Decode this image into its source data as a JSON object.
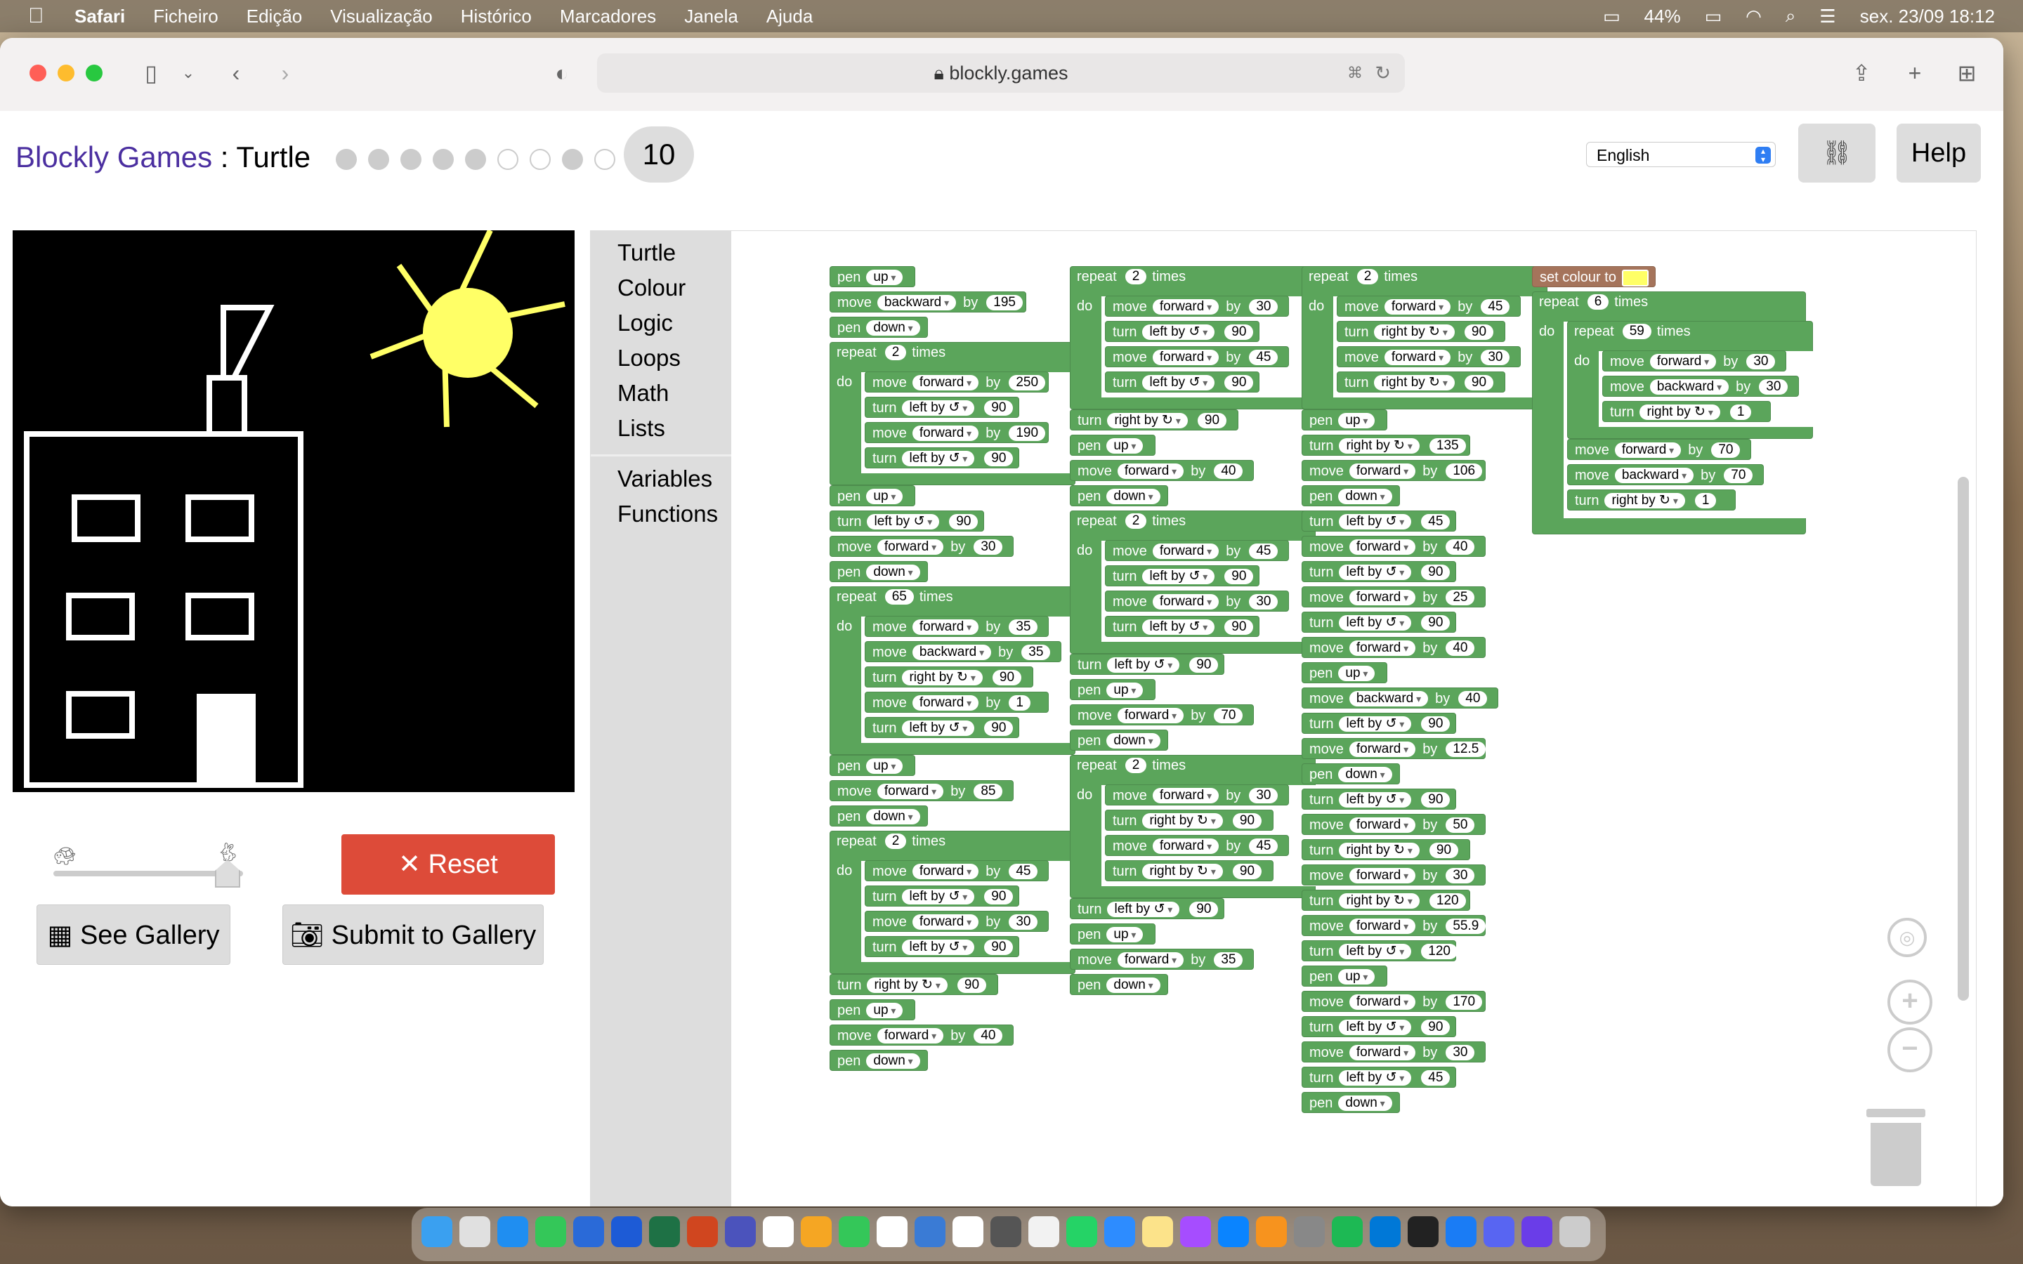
{
  "menubar": {
    "app": "Safari",
    "items": [
      "Ficheiro",
      "Edição",
      "Visualização",
      "Histórico",
      "Marcadores",
      "Janela",
      "Ajuda"
    ],
    "battery": "44%",
    "clock": "sex. 23/09  18:12"
  },
  "browser": {
    "url": "blockly.games"
  },
  "page": {
    "brand": "Blockly Games",
    "separator": " : ",
    "game": "Turtle",
    "level": "10",
    "language": "English",
    "help": "Help",
    "reset": "Reset",
    "see_gallery": "See Gallery",
    "submit_gallery": "Submit to Gallery"
  },
  "toolbox": [
    "Turtle",
    "Colour",
    "Logic",
    "Loops",
    "Math",
    "Lists",
    "Variables",
    "Functions"
  ],
  "blocks": {
    "pen": "pen",
    "move": "move",
    "by": "by",
    "turn": "turn",
    "repeat": "repeat",
    "times": "times",
    "do": "do",
    "set_colour": "set colour to",
    "up": "up",
    "down": "down",
    "forward": "forward",
    "backward": "backward",
    "left": "left by ↺",
    "right": "right by ↻"
  },
  "code": {
    "col1": [
      [
        "pen",
        "up"
      ],
      [
        "move",
        "backward",
        "195"
      ],
      [
        "pen",
        "down"
      ],
      [
        "repeat",
        "2",
        [
          [
            "move",
            "forward",
            "250"
          ],
          [
            "turn",
            "left",
            "90"
          ],
          [
            "move",
            "forward",
            "190"
          ],
          [
            "turn",
            "left",
            "90"
          ]
        ]
      ],
      [
        "pen",
        "up"
      ],
      [
        "turn",
        "left",
        "90"
      ],
      [
        "move",
        "forward",
        "30"
      ],
      [
        "pen",
        "down"
      ],
      [
        "repeat",
        "65",
        [
          [
            "move",
            "forward",
            "35"
          ],
          [
            "move",
            "backward",
            "35"
          ],
          [
            "turn",
            "right",
            "90"
          ],
          [
            "move",
            "forward",
            "1"
          ],
          [
            "turn",
            "left",
            "90"
          ]
        ]
      ],
      [
        "pen",
        "up"
      ],
      [
        "move",
        "forward",
        "85"
      ],
      [
        "pen",
        "down"
      ],
      [
        "repeat",
        "2",
        [
          [
            "move",
            "forward",
            "45"
          ],
          [
            "turn",
            "left",
            "90"
          ],
          [
            "move",
            "forward",
            "30"
          ],
          [
            "turn",
            "left",
            "90"
          ]
        ]
      ],
      [
        "turn",
        "right",
        "90"
      ],
      [
        "pen",
        "up"
      ],
      [
        "move",
        "forward",
        "40"
      ],
      [
        "pen",
        "down"
      ]
    ],
    "col2": [
      [
        "repeat",
        "2",
        [
          [
            "move",
            "forward",
            "30"
          ],
          [
            "turn",
            "left",
            "90"
          ],
          [
            "move",
            "forward",
            "45"
          ],
          [
            "turn",
            "left",
            "90"
          ]
        ]
      ],
      [
        "turn",
        "right",
        "90"
      ],
      [
        "pen",
        "up"
      ],
      [
        "move",
        "forward",
        "40"
      ],
      [
        "pen",
        "down"
      ],
      [
        "repeat",
        "2",
        [
          [
            "move",
            "forward",
            "45"
          ],
          [
            "turn",
            "left",
            "90"
          ],
          [
            "move",
            "forward",
            "30"
          ],
          [
            "turn",
            "left",
            "90"
          ]
        ]
      ],
      [
        "turn",
        "left",
        "90"
      ],
      [
        "pen",
        "up"
      ],
      [
        "move",
        "forward",
        "70"
      ],
      [
        "pen",
        "down"
      ],
      [
        "repeat",
        "2",
        [
          [
            "move",
            "forward",
            "30"
          ],
          [
            "turn",
            "right",
            "90"
          ],
          [
            "move",
            "forward",
            "45"
          ],
          [
            "turn",
            "right",
            "90"
          ]
        ]
      ],
      [
        "turn",
        "left",
        "90"
      ],
      [
        "pen",
        "up"
      ],
      [
        "move",
        "forward",
        "35"
      ],
      [
        "pen",
        "down"
      ]
    ],
    "col3": [
      [
        "repeat",
        "2",
        [
          [
            "move",
            "forward",
            "45"
          ],
          [
            "turn",
            "right",
            "90"
          ],
          [
            "move",
            "forward",
            "30"
          ],
          [
            "turn",
            "right",
            "90"
          ]
        ]
      ],
      [
        "pen",
        "up"
      ],
      [
        "turn",
        "right",
        "135"
      ],
      [
        "move",
        "forward",
        "106"
      ],
      [
        "pen",
        "down"
      ],
      [
        "turn",
        "left",
        "45"
      ],
      [
        "move",
        "forward",
        "40"
      ],
      [
        "turn",
        "left",
        "90"
      ],
      [
        "move",
        "forward",
        "25"
      ],
      [
        "turn",
        "left",
        "90"
      ],
      [
        "move",
        "forward",
        "40"
      ],
      [
        "pen",
        "up"
      ],
      [
        "move",
        "backward",
        "40"
      ],
      [
        "turn",
        "left",
        "90"
      ],
      [
        "move",
        "forward",
        "12.5"
      ],
      [
        "pen",
        "down"
      ],
      [
        "turn",
        "left",
        "90"
      ],
      [
        "move",
        "forward",
        "50"
      ],
      [
        "turn",
        "right",
        "90"
      ],
      [
        "move",
        "forward",
        "30"
      ],
      [
        "turn",
        "right",
        "120"
      ],
      [
        "move",
        "forward",
        "55.9"
      ],
      [
        "turn",
        "left",
        "120"
      ],
      [
        "pen",
        "up"
      ],
      [
        "move",
        "forward",
        "170"
      ],
      [
        "turn",
        "left",
        "90"
      ],
      [
        "move",
        "forward",
        "30"
      ],
      [
        "turn",
        "left",
        "45"
      ],
      [
        "pen",
        "down"
      ]
    ],
    "col4": {
      "colour": "#ffff66",
      "outer_times": "6",
      "inner_times": "59",
      "inner": [
        [
          "move",
          "forward",
          "30"
        ],
        [
          "move",
          "backward",
          "30"
        ],
        [
          "turn",
          "right",
          "1"
        ]
      ],
      "after": [
        [
          "move",
          "forward",
          "70"
        ],
        [
          "move",
          "backward",
          "70"
        ],
        [
          "turn",
          "right",
          "1"
        ]
      ]
    }
  }
}
